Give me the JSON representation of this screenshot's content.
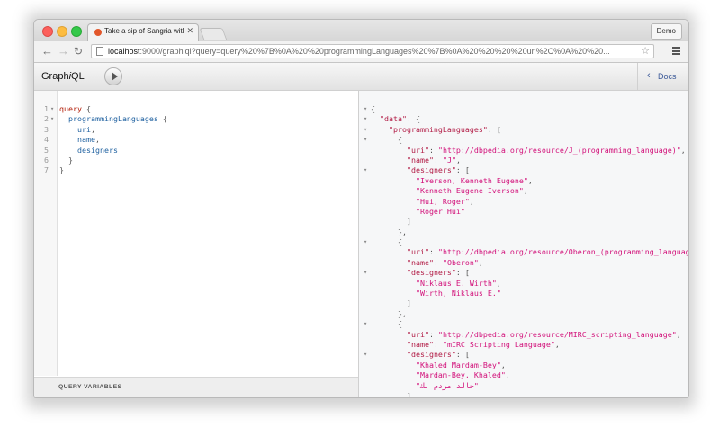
{
  "browser": {
    "tab_title": "Take a sip of Sangria with G",
    "profile_label": "Demo",
    "url_host": "localhost",
    "url_rest": ":9000/graphiql?query=query%20%7B%0A%20%20programmingLanguages%20%7B%0A%20%20%20%20uri%2C%0A%20%20..."
  },
  "graphiql": {
    "title_prefix": "Graph",
    "title_italic": "i",
    "title_suffix": "QL",
    "docs_label": "Docs",
    "query_variables_label": "QUERY VARIABLES"
  },
  "query_lines": [
    {
      "num": "1",
      "fold": "▾",
      "text": "query {"
    },
    {
      "num": "2",
      "fold": "▾",
      "text": "  programmingLanguages {"
    },
    {
      "num": "3",
      "fold": "",
      "text": "    uri,"
    },
    {
      "num": "4",
      "fold": "",
      "text": "    name,"
    },
    {
      "num": "5",
      "fold": "",
      "text": "    designers"
    },
    {
      "num": "6",
      "fold": "",
      "text": "  }"
    },
    {
      "num": "7",
      "fold": "",
      "text": "}"
    }
  ],
  "result_lines": [
    {
      "fold": "▾",
      "text": "{"
    },
    {
      "fold": "▾",
      "text": "  \"data\": {"
    },
    {
      "fold": "▾",
      "text": "    \"programmingLanguages\": ["
    },
    {
      "fold": "▾",
      "text": "      {"
    },
    {
      "fold": "",
      "text": "        \"uri\": \"http://dbpedia.org/resource/J_(programming_language)\","
    },
    {
      "fold": "",
      "text": "        \"name\": \"J\","
    },
    {
      "fold": "▾",
      "text": "        \"designers\": ["
    },
    {
      "fold": "",
      "text": "          \"Iverson, Kenneth Eugene\","
    },
    {
      "fold": "",
      "text": "          \"Kenneth Eugene Iverson\","
    },
    {
      "fold": "",
      "text": "          \"Hui, Roger\","
    },
    {
      "fold": "",
      "text": "          \"Roger Hui\""
    },
    {
      "fold": "",
      "text": "        ]"
    },
    {
      "fold": "",
      "text": "      },"
    },
    {
      "fold": "▾",
      "text": "      {"
    },
    {
      "fold": "",
      "text": "        \"uri\": \"http://dbpedia.org/resource/Oberon_(programming_language)\","
    },
    {
      "fold": "",
      "text": "        \"name\": \"Oberon\","
    },
    {
      "fold": "▾",
      "text": "        \"designers\": ["
    },
    {
      "fold": "",
      "text": "          \"Niklaus E. Wirth\","
    },
    {
      "fold": "",
      "text": "          \"Wirth, Niklaus E.\""
    },
    {
      "fold": "",
      "text": "        ]"
    },
    {
      "fold": "",
      "text": "      },"
    },
    {
      "fold": "▾",
      "text": "      {"
    },
    {
      "fold": "",
      "text": "        \"uri\": \"http://dbpedia.org/resource/MIRC_scripting_language\","
    },
    {
      "fold": "",
      "text": "        \"name\": \"mIRC Scripting Language\","
    },
    {
      "fold": "▾",
      "text": "        \"designers\": ["
    },
    {
      "fold": "",
      "text": "          \"Khaled Mardam-Bey\","
    },
    {
      "fold": "",
      "text": "          \"Mardam-Bey, Khaled\","
    },
    {
      "fold": "",
      "text": "          \"خالد مردم بك\""
    },
    {
      "fold": "",
      "text": "        ]"
    }
  ]
}
